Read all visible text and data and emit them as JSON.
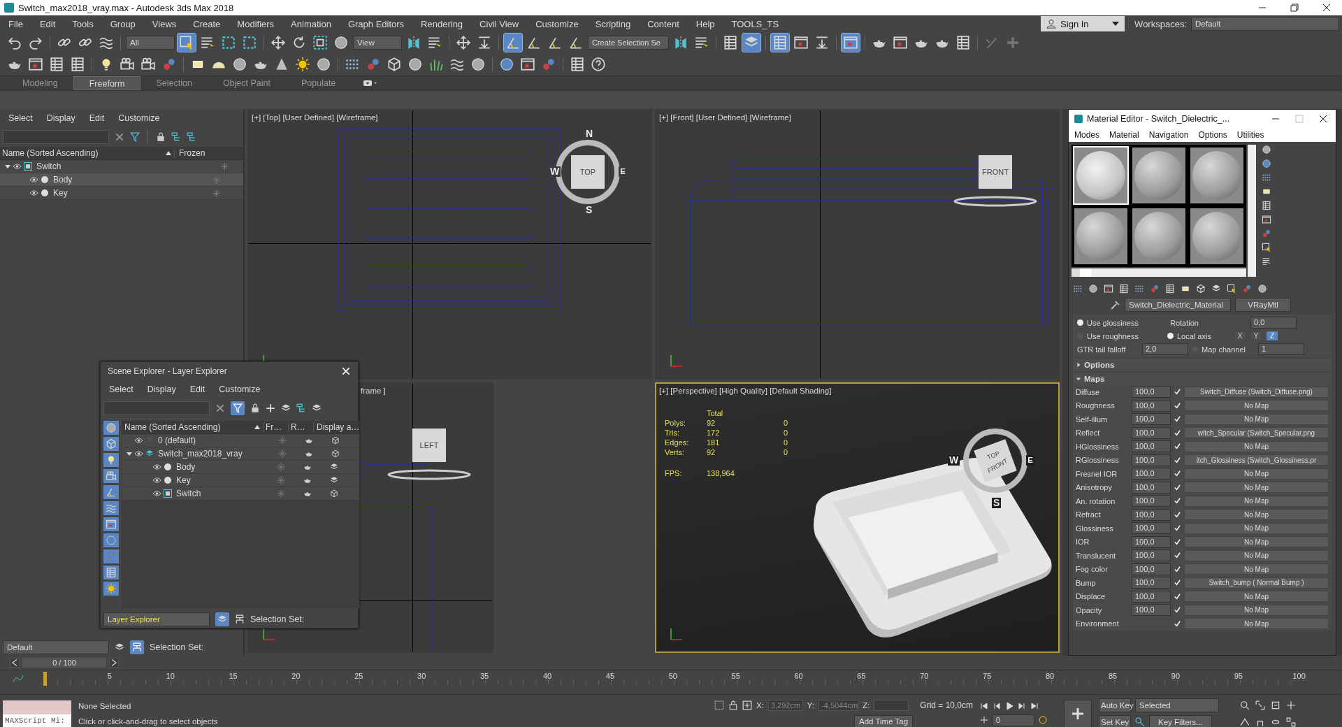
{
  "window": {
    "title": "Switch_max2018_vray.max - Autodesk 3ds Max 2018"
  },
  "menu_bar": [
    "File",
    "Edit",
    "Tools",
    "Group",
    "Views",
    "Create",
    "Modifiers",
    "Animation",
    "Graph Editors",
    "Rendering",
    "Civil View",
    "Customize",
    "Scripting",
    "Content",
    "Help",
    "TOOLS_TS"
  ],
  "account": {
    "sign_in": "Sign In",
    "workspaces_label": "Workspaces:",
    "workspace": "Default"
  },
  "main_toolbar": {
    "selection_filter": "All",
    "reference_coordinate": "View",
    "named_selection": "Create Selection Se",
    "toggles": {
      "select_object": true,
      "angle_snap": true,
      "scene_explorer": true,
      "layer_explorer": true,
      "render_frame": true
    }
  },
  "ribbon": {
    "tabs": [
      {
        "label": "Modeling",
        "selected": false
      },
      {
        "label": "Freeform",
        "selected": true
      },
      {
        "label": "Selection",
        "selected": false
      },
      {
        "label": "Object Paint",
        "selected": false
      },
      {
        "label": "Populate",
        "selected": false
      }
    ]
  },
  "scene_explorer": {
    "menu": [
      "Select",
      "Display",
      "Edit",
      "Customize"
    ],
    "columns": [
      "Name (Sorted Ascending)",
      "Frozen"
    ],
    "tree": [
      {
        "name": "Switch",
        "kind": "group",
        "expanded": true,
        "selected": false,
        "children": [
          {
            "name": "Body",
            "kind": "object",
            "selected": true
          },
          {
            "name": "Key",
            "kind": "object",
            "selected": false
          }
        ]
      }
    ],
    "layer": "Default",
    "selection_set_label": "Selection Set:"
  },
  "layer_explorer": {
    "title": "Scene Explorer - Layer Explorer",
    "menu": [
      "Select",
      "Display",
      "Edit",
      "Customize"
    ],
    "columns": [
      "Name (Sorted Ascending)",
      "Fr…",
      "R…",
      "Display a…"
    ],
    "tree": [
      {
        "name": "0 (default)",
        "kind": "layer"
      },
      {
        "name": "Switch_max2018_vray",
        "kind": "layer",
        "expanded": true,
        "children": [
          {
            "name": "Body",
            "kind": "object"
          },
          {
            "name": "Key",
            "kind": "object"
          },
          {
            "name": "Switch",
            "kind": "group"
          }
        ]
      }
    ],
    "explorer_type": "Layer Explorer",
    "selection_set_label": "Selection Set:"
  },
  "viewports": [
    {
      "label": "[+] [Top] [User Defined] [Wireframe]",
      "kind": "top",
      "active": false,
      "cube": "TOP",
      "compass": [
        "N",
        "W",
        "E",
        "S"
      ]
    },
    {
      "label": "[+] [Front] [User Defined] [Wireframe]",
      "kind": "front",
      "active": false,
      "cube": "FRONT"
    },
    {
      "label": "frame ]",
      "kind": "left",
      "active": false,
      "cube": "LEFT"
    },
    {
      "label": "[+] [Perspective] [High Quality] [Default Shading]",
      "kind": "perspective",
      "active": true,
      "cube": "TOP",
      "cube_side": "FRONT",
      "compass": [
        "W",
        "E",
        "S"
      ],
      "stats": {
        "header": "Total",
        "rows": [
          {
            "label": "Polys:",
            "total": "92",
            "selection": "0"
          },
          {
            "label": "Tris:",
            "total": "172",
            "selection": "0"
          },
          {
            "label": "Edges:",
            "total": "181",
            "selection": "0"
          },
          {
            "label": "Verts:",
            "total": "92",
            "selection": "0"
          }
        ],
        "fps_label": "FPS:",
        "fps": "138,964"
      }
    }
  ],
  "material_editor": {
    "title": "Material Editor - Switch_Dielectric_...",
    "menu": [
      "Modes",
      "Material",
      "Navigation",
      "Options",
      "Utilities"
    ],
    "slots": [
      {
        "selected": true,
        "kind": "textured"
      },
      {
        "selected": false,
        "kind": "plain"
      },
      {
        "selected": false,
        "kind": "plain"
      },
      {
        "selected": false,
        "kind": "plain"
      },
      {
        "selected": false,
        "kind": "plain"
      },
      {
        "selected": false,
        "kind": "plain"
      }
    ],
    "material_name": "Switch_Dielectric_Material",
    "material_type": "VRayMtl",
    "params": {
      "use_glossiness": {
        "label": "Use glossiness",
        "selected": true
      },
      "use_roughness": {
        "label": "Use roughness",
        "selected": false
      },
      "gtr_label": "GTR tail falloff",
      "gtr": "2,0",
      "rotation_label": "Rotation",
      "rotation": "0,0",
      "local_axis": {
        "label": "Local axis",
        "selected": true
      },
      "axes": [
        {
          "label": "X",
          "selected": false
        },
        {
          "label": "Y",
          "selected": false
        },
        {
          "label": "Z",
          "selected": true
        }
      ],
      "map_channel": {
        "label": "Map channel",
        "selected": false
      },
      "channel": "1"
    },
    "rollouts": [
      {
        "title": "Options",
        "expanded": false
      },
      {
        "title": "Maps",
        "expanded": true
      }
    ],
    "maps": [
      {
        "name": "Diffuse",
        "amount": "100,0",
        "checked": true,
        "map": "Switch_Diffuse (Switch_Diffuse.png)"
      },
      {
        "name": "Roughness",
        "amount": "100,0",
        "checked": true,
        "map": "No Map"
      },
      {
        "name": "Self-illum",
        "amount": "100,0",
        "checked": true,
        "map": "No Map"
      },
      {
        "name": "Reflect",
        "amount": "100,0",
        "checked": true,
        "map": "witch_Specular (Switch_Specular.png"
      },
      {
        "name": "HGlossiness",
        "amount": "100,0",
        "checked": true,
        "map": "No Map"
      },
      {
        "name": "RGlossiness",
        "amount": "100,0",
        "checked": true,
        "map": "itch_Glossiness (Switch_Glossiness.pr"
      },
      {
        "name": "Fresnel IOR",
        "amount": "100,0",
        "checked": true,
        "map": "No Map"
      },
      {
        "name": "Anisotropy",
        "amount": "100,0",
        "checked": true,
        "map": "No Map"
      },
      {
        "name": "An. rotation",
        "amount": "100,0",
        "checked": true,
        "map": "No Map"
      },
      {
        "name": "Refract",
        "amount": "100,0",
        "checked": true,
        "map": "No Map"
      },
      {
        "name": "Glossiness",
        "amount": "100,0",
        "checked": true,
        "map": "No Map"
      },
      {
        "name": "IOR",
        "amount": "100,0",
        "checked": true,
        "map": "No Map"
      },
      {
        "name": "Translucent",
        "amount": "100,0",
        "checked": true,
        "map": "No Map"
      },
      {
        "name": "Fog color",
        "amount": "100,0",
        "checked": true,
        "map": "No Map"
      },
      {
        "name": "Bump",
        "amount": "100,0",
        "checked": true,
        "map": "Switch_bump  ( Normal Bump )"
      },
      {
        "name": "Displace",
        "amount": "100,0",
        "checked": true,
        "map": "No Map"
      },
      {
        "name": "Opacity",
        "amount": "100,0",
        "checked": true,
        "map": "No Map"
      },
      {
        "name": "Environment",
        "checked": true,
        "map": "No Map"
      }
    ]
  },
  "time_slider": {
    "frame": "0 / 100",
    "level": 0.0
  },
  "ruler_labels": [
    "5",
    "10",
    "15",
    "20",
    "25",
    "30",
    "35",
    "40",
    "45",
    "50",
    "55",
    "60",
    "65",
    "70",
    "75",
    "80",
    "85",
    "90",
    "95",
    "100"
  ],
  "status_bar": {
    "maxscript": "MAXScript Mi:",
    "selection": "None Selected",
    "prompt": "Click or click-and-drag to select objects",
    "x": "3,292cm",
    "y": "-4,5044cm",
    "x_label": "X:",
    "y_label": "Y:",
    "z_label": "Z:",
    "grid": "Grid = 10,0cm",
    "add_time_tag": "Add Time Tag",
    "auto_key": "Auto Key",
    "set_key": "Set Key",
    "key_mode": "Selected",
    "key_filters": "Key Filters...",
    "current_frame": "0"
  }
}
